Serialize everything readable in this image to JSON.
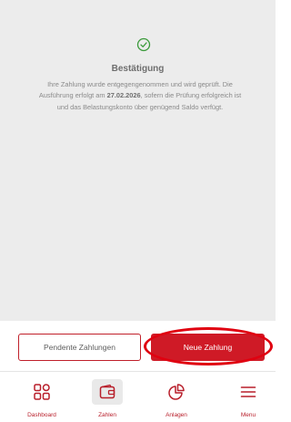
{
  "confirmation": {
    "icon": "check-circle-icon",
    "title": "Bestätigung",
    "text_before": "Ihre Zahlung wurde entgegengenommen und wird geprüft. Die Ausführung erfolgt am ",
    "date": "27.02.2026",
    "text_after": ", sofern die Prüfung erfolgreich ist und das Belastungskonto über genügend Saldo verfügt."
  },
  "actions": {
    "secondary_label": "Pendente Zahlungen",
    "primary_label": "Neue Zahlung"
  },
  "nav": {
    "items": [
      {
        "label": "Dashboard",
        "icon": "grid-icon"
      },
      {
        "label": "Zahlen",
        "icon": "wallet-icon",
        "active": true
      },
      {
        "label": "Anlagen",
        "icon": "pie-chart-icon"
      },
      {
        "label": "Menu",
        "icon": "hamburger-menu-icon"
      }
    ]
  },
  "colors": {
    "brand_red": "#cf1a26",
    "success_green": "#3a9a3a",
    "content_bg": "#ececec"
  }
}
